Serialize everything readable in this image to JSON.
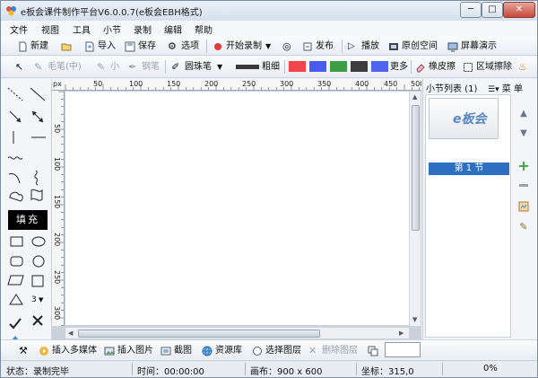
{
  "window": {
    "title": "e板会课件制作平台V6.0.0.7(e板会EBH格式)",
    "min_glyph": "─",
    "max_glyph": "□",
    "close_glyph": "✕"
  },
  "menu": [
    "文件",
    "视图",
    "工具",
    "小节",
    "录制",
    "编辑",
    "帮助"
  ],
  "toolbar1": {
    "new": "新建",
    "open_icon": "folder-open-icon",
    "import": "导入",
    "save": "保存",
    "options": "选项",
    "start_record": "开始录制",
    "publish": "发布",
    "play": "播放",
    "original_space": "原创空间",
    "screen_demo": "屏幕演示"
  },
  "toolbar2": {
    "brush": "毛笔(中)",
    "small": "小",
    "pen": "钢笔",
    "ballpoint": "圆珠笔",
    "thickness": "粗细",
    "more": "更多",
    "eraser": "橡皮擦",
    "region_erase": "区域擦除",
    "colors": [
      "#f0454b",
      "#4a5cf0",
      "#3e9e47",
      "#3d3d3d",
      "#4f63ef"
    ]
  },
  "palette": {
    "fill_label": "填充",
    "polygon_count": "3"
  },
  "ruler": {
    "unit": "px",
    "top": [
      "50",
      "100",
      "150",
      "200",
      "250",
      "300",
      "350",
      "400",
      "450",
      "500"
    ],
    "left": [
      "50",
      "100",
      "150",
      "200",
      "250",
      "300"
    ]
  },
  "right_panel": {
    "title": "小节列表 (1)",
    "menu": "菜 单",
    "thumb_logo": "e板会",
    "section": "第 1 节"
  },
  "bottom": {
    "insert_media": "插入多媒体",
    "insert_image": "插入图片",
    "screenshot": "截图",
    "resource": "资源库",
    "select_layer": "选择图层",
    "delete_layer": "删除图层"
  },
  "status": {
    "state": "状态：录制完毕",
    "time": "时间：00:00:00",
    "canvas": "画布：900 x 600",
    "coord": "坐标：315,0",
    "percent": "0%"
  }
}
